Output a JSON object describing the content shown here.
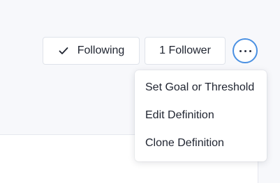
{
  "actions": {
    "following_label": "Following",
    "followers_label": "1 Follower",
    "more_icon": "ellipsis-icon",
    "check_icon": "check-icon",
    "focus_ring_color": "#4a90e2"
  },
  "menu": {
    "items": [
      {
        "label": "Set Goal or Threshold"
      },
      {
        "label": "Edit Definition"
      },
      {
        "label": "Clone Definition"
      }
    ]
  }
}
